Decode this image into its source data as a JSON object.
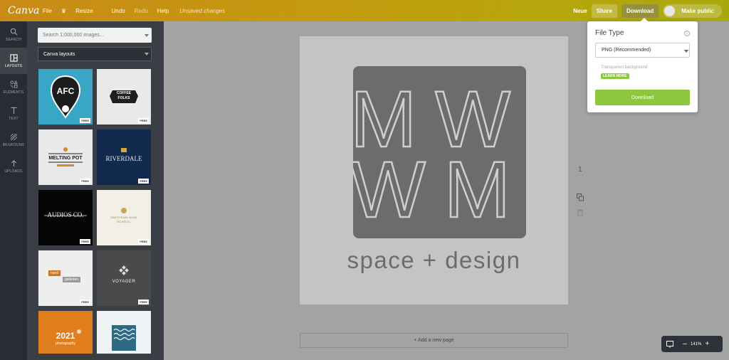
{
  "app": {
    "logo": "Canva"
  },
  "menu": {
    "file": "File",
    "resize": "Resize",
    "undo": "Undo",
    "redo": "Redo",
    "help": "Help",
    "status": "Unsaved changes"
  },
  "topbar": {
    "neue": "Neue",
    "share": "Share",
    "download": "Download",
    "make_public": "Make public"
  },
  "rail": [
    {
      "label": "SEARCH",
      "icon": "search-icon"
    },
    {
      "label": "LAYOUTS",
      "icon": "layouts-icon"
    },
    {
      "label": "ELEMENTS",
      "icon": "elements-icon"
    },
    {
      "label": "TEXT",
      "icon": "text-icon"
    },
    {
      "label": "BKGROUND",
      "icon": "background-icon"
    },
    {
      "label": "UPLOADS",
      "icon": "upload-icon"
    }
  ],
  "panel": {
    "search_placeholder": "Search 1,000,000 images...",
    "layouts_dropdown": "Canva layouts",
    "thumbs": [
      {
        "title": "AFC",
        "badge": "FREE"
      },
      {
        "title": "COFFEE FOLKS",
        "badge": "FREE"
      },
      {
        "title": "MELTING POT",
        "badge": "FREE"
      },
      {
        "title": "RIVERDALE",
        "badge": "FREE"
      },
      {
        "title": "AUDIOS CO.",
        "badge": "FREE"
      },
      {
        "title": "SMITHSON HIGH SCHOOL",
        "badge": "FREE"
      },
      {
        "title": "hand gallery",
        "badge": "FREE"
      },
      {
        "title": "VOYAGER",
        "badge": "FREE"
      },
      {
        "title": "2021 photography",
        "badge": ""
      },
      {
        "title": "",
        "badge": ""
      }
    ],
    "thumb_extra": {
      "melting_sub": "",
      "hand_line1": "hand",
      "hand_line2": "gallerian",
      "year": "2021",
      "photography": "photography"
    }
  },
  "canvas": {
    "monogram_line1": "MW",
    "monogram_line2": "WM",
    "tagline": "space + design",
    "page_number": "1",
    "add_page": "+ Add a new page"
  },
  "zoom": {
    "level": "141%",
    "minus": "–",
    "plus": "+"
  },
  "download_popup": {
    "file_type_label": "File Type",
    "info": "i",
    "file_type_value": "PNG (Recommended)",
    "transparent": "Transparent background",
    "learn_more": "LEARN MORE",
    "download_button": "Download"
  },
  "colors": {
    "topbar_start": "#c98a16",
    "topbar_end": "#a8a80c",
    "accent_green": "#8dc63f",
    "rail_bg": "#292d33",
    "panel_bg": "#3a3f46",
    "canvas_bg": "#a3a3a3",
    "monogram_bg": "#6c6c6c"
  }
}
